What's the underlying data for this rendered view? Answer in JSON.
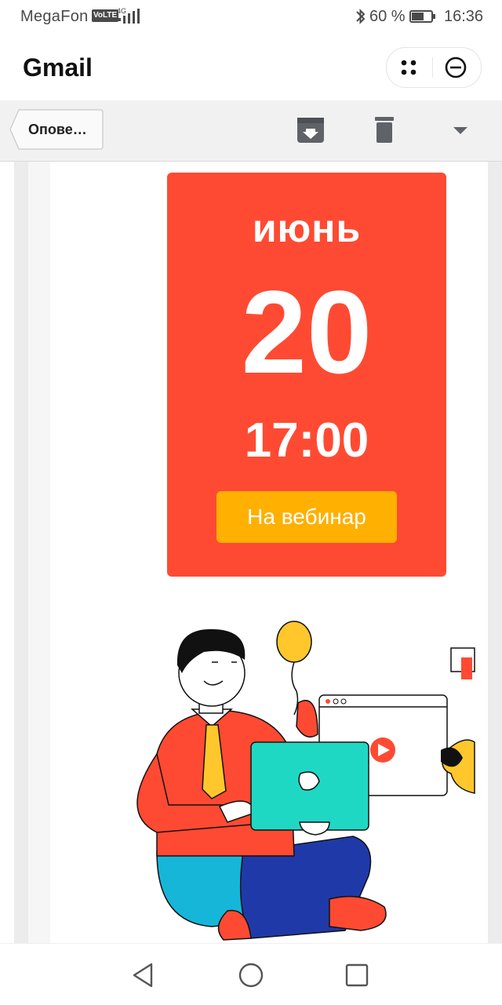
{
  "status_bar": {
    "carrier": "MegaFon",
    "volte": "VoLTE",
    "network": "4G",
    "battery_percent": "60 %",
    "time": "16:36"
  },
  "app_bar": {
    "title": "Gmail",
    "icons": [
      "more-dots-icon",
      "close-circle-icon"
    ]
  },
  "toolbar": {
    "back_label": "Опове…",
    "icons": [
      "archive-icon",
      "delete-icon",
      "dropdown-arrow-icon"
    ]
  },
  "email": {
    "card": {
      "month": "июнь",
      "day": "20",
      "time": "17:00",
      "button_label": "На вебинар"
    },
    "colors": {
      "card": "#ff4a33",
      "button": "#ffb000",
      "laptop": "#1fd8c4"
    }
  },
  "nav_bar": {
    "icons": [
      "back-triangle-icon",
      "home-circle-icon",
      "recents-square-icon"
    ]
  }
}
